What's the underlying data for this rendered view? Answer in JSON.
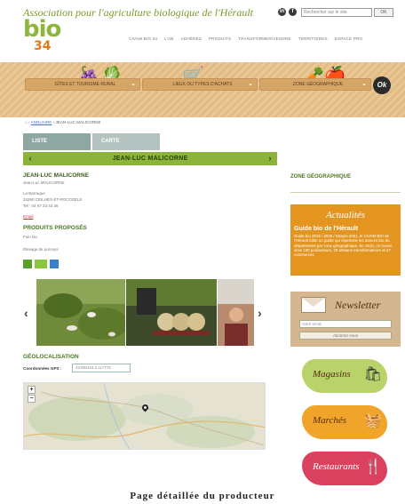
{
  "header": {
    "assoc_title": "Association pour l'agriculture biologique de l'Hérault",
    "logo_text": "bio",
    "logo_number": "34",
    "search_placeholder": "Rechercher sur le site",
    "search_ok": "OK",
    "nav": [
      "CIVAM BIO 34",
      "L'AB",
      "ADHÉREZ",
      "PRODUITS",
      "TRANSFORMER/VENDRE",
      "TERRITOIRES",
      "ESPACE PRO"
    ]
  },
  "filters": {
    "items": [
      {
        "label": "GÎTES ET TOURISME RURAL"
      },
      {
        "label": "LIEUX OU TYPES D'ACHATS"
      },
      {
        "label": "ZONE GÉOGRAPHIQUE"
      }
    ],
    "ok_label": "Ok"
  },
  "breadcrumb": {
    "home": "⌂",
    "directory": "ANNUAIRE",
    "current": "JEAN-LUC MALICORNE"
  },
  "tabs": [
    {
      "label": "LISTE"
    },
    {
      "label": "CARTE"
    }
  ],
  "producer": {
    "title": "JEAN-LUC MALICORNE",
    "name": "JEAN-LUC MALICORNE",
    "contact": "Jean-Luc MALICORNE",
    "address1": "La Barraque",
    "address2": "34260 CEILHES-ET-ROCOZELS",
    "phone": "Tel : 04 67 23 43 46",
    "email": "Email"
  },
  "products": {
    "title": "PRODUITS PROPOSÉS",
    "lines": [
      "Foin bio",
      "Élevage de porceys"
    ]
  },
  "geo": {
    "title": "GÉOLOCALISATION",
    "coords_label": "Coordonnées GPS :",
    "coords_value": "43.693118,3.117776",
    "zoom_in": "+",
    "zoom_out": "−"
  },
  "sidebar": {
    "zone_title": "ZONE GÉOGRAPHIQUE",
    "news_cap": "Actualités",
    "guide_title": "Guide bio de l'Hérault",
    "guide_body": "Guide bio 2016 / 2026 / Depuis 2001, le CIVAM BIO de l'Hérault édite un guide qui répertorie les acteurs bio du département par zone géographique. En 2016, on trouve ainsi 150 producteurs, 20 artisans transformateurs et 47 commerces",
    "newsletter_cap": "Newsletter",
    "newsletter_placeholder": "Votre email",
    "newsletter_button": "Abonnez-vous",
    "magasins": "Magasins",
    "marches": "Marchés",
    "restaurants": "Restaurants"
  },
  "caption": "Page détaillée du producteur",
  "colors": {
    "green": "#8cb43a",
    "orange": "#e39520",
    "tan": "#d4b690",
    "tab": "#8fa7a3"
  }
}
